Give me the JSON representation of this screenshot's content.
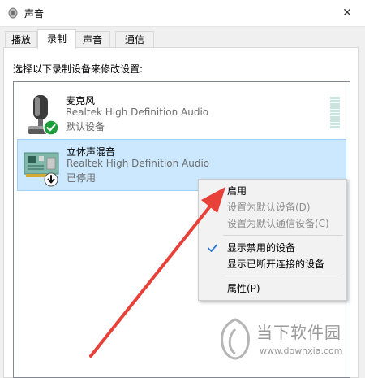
{
  "window": {
    "title": "声音",
    "close_glyph": "✕"
  },
  "tabs": [
    {
      "label": "播放",
      "active": false
    },
    {
      "label": "录制",
      "active": true
    },
    {
      "label": "声音",
      "active": false
    },
    {
      "label": "通信",
      "active": false
    }
  ],
  "instruction": "选择以下录制设备来修改设置:",
  "devices": [
    {
      "name": "麦克风",
      "description": "Realtek High Definition Audio",
      "status": "默认设备",
      "icon": "microphone-icon",
      "badge": "default-check-icon",
      "selected": false
    },
    {
      "name": "立体声混音",
      "description": "Realtek High Definition Audio",
      "status": "已停用",
      "icon": "sound-card-icon",
      "badge": "disabled-arrow-icon",
      "selected": true
    }
  ],
  "context_menu": {
    "items": [
      {
        "label": "启用",
        "disabled": false,
        "checked": false
      },
      {
        "label": "设置为默认设备(D)",
        "disabled": true,
        "checked": false
      },
      {
        "label": "设置为默认通信设备(C)",
        "disabled": true,
        "checked": false
      },
      {
        "label": "显示禁用的设备",
        "disabled": false,
        "checked": true
      },
      {
        "label": "显示已断开连接的设备",
        "disabled": false,
        "checked": false
      },
      {
        "label": "属性(P)",
        "disabled": false,
        "checked": false
      }
    ]
  },
  "watermark": {
    "brand": "当下软件园",
    "url": "www.downxia.com"
  },
  "colors": {
    "selection_bg": "#cce8ff",
    "selection_border": "#99d1ff",
    "arrow": "#e8413a",
    "check_green": "#1e9e3a",
    "menu_check": "#2a7bd5"
  }
}
